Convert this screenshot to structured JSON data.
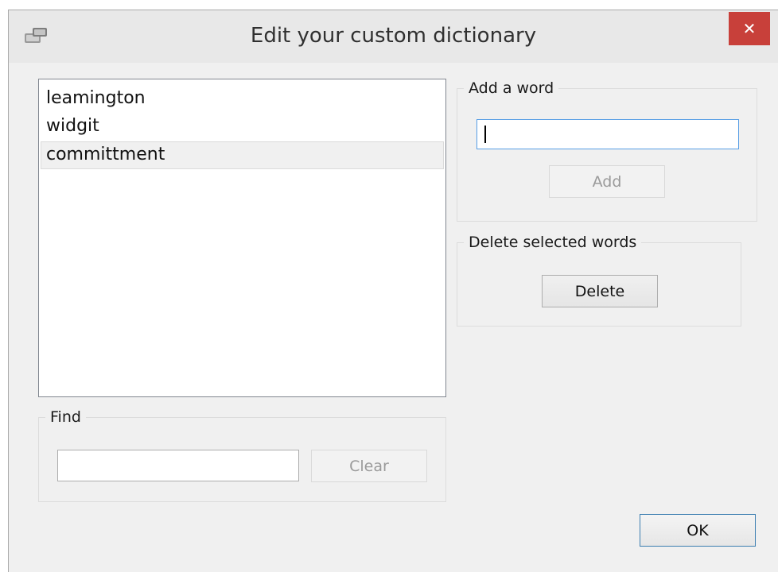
{
  "window": {
    "title": "Edit your custom dictionary",
    "close_glyph": "✕",
    "app_icon": "dictionary-app-icon"
  },
  "word_list": {
    "items": [
      "leamington",
      "widgit",
      "committment"
    ],
    "selected_index": 2
  },
  "add_group": {
    "label": "Add a word",
    "input_value": "",
    "add_button": "Add"
  },
  "delete_group": {
    "label": "Delete selected words",
    "delete_button": "Delete"
  },
  "find_group": {
    "label": "Find",
    "input_value": "",
    "clear_button": "Clear"
  },
  "ok_button": "OK",
  "colors": {
    "close_red": "#c8403a",
    "focus_blue": "#569de5",
    "default_button_border": "#3c7fb1"
  }
}
